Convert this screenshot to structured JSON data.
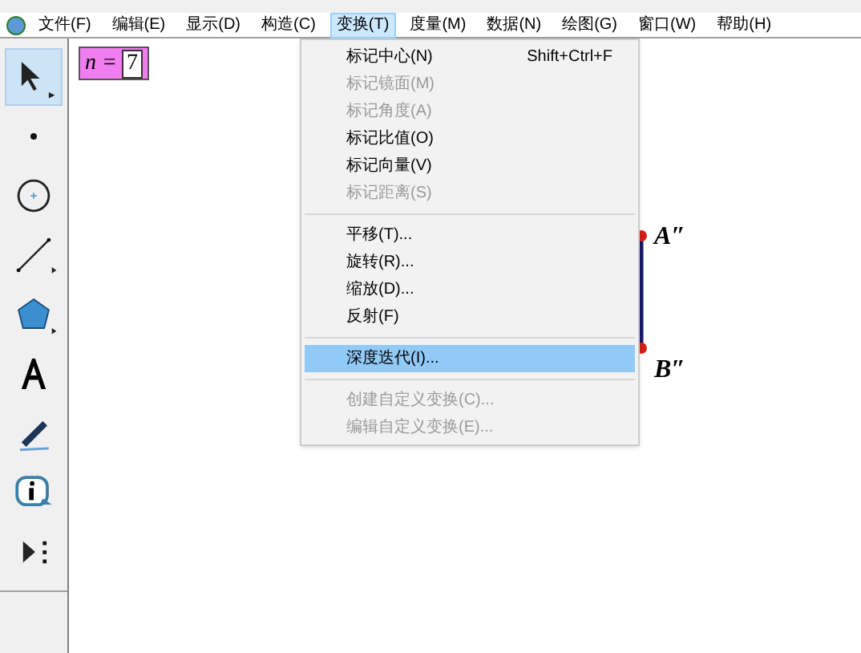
{
  "menubar": [
    {
      "label": "文件(F)",
      "selected": false
    },
    {
      "label": "编辑(E)",
      "selected": false
    },
    {
      "label": "显示(D)",
      "selected": false
    },
    {
      "label": "构造(C)",
      "selected": false
    },
    {
      "label": "变换(T)",
      "selected": true
    },
    {
      "label": "度量(M)",
      "selected": false
    },
    {
      "label": "数据(N)",
      "selected": false
    },
    {
      "label": "绘图(G)",
      "selected": false
    },
    {
      "label": "窗口(W)",
      "selected": false
    },
    {
      "label": "帮助(H)",
      "selected": false
    }
  ],
  "menu": {
    "groups": [
      [
        {
          "label": "标记中心(N)",
          "shortcut": "Shift+Ctrl+F",
          "disabled": false,
          "selected": false
        },
        {
          "label": "标记镜面(M)",
          "disabled": true,
          "selected": false
        },
        {
          "label": "标记角度(A)",
          "disabled": true,
          "selected": false
        },
        {
          "label": "标记比值(O)",
          "disabled": false,
          "selected": false
        },
        {
          "label": "标记向量(V)",
          "disabled": false,
          "selected": false
        },
        {
          "label": "标记距离(S)",
          "disabled": true,
          "selected": false
        }
      ],
      [
        {
          "label": "平移(T)...",
          "disabled": false,
          "selected": false
        },
        {
          "label": "旋转(R)...",
          "disabled": false,
          "selected": false
        },
        {
          "label": "缩放(D)...",
          "disabled": false,
          "selected": false
        },
        {
          "label": "反射(F)",
          "disabled": false,
          "selected": false
        }
      ],
      [
        {
          "label": "深度迭代(I)...",
          "disabled": false,
          "selected": true
        }
      ],
      [
        {
          "label": "创建自定义变换(C)...",
          "disabled": true,
          "selected": false
        },
        {
          "label": "编辑自定义变换(E)...",
          "disabled": true,
          "selected": false
        }
      ]
    ]
  },
  "tools": [
    {
      "kind": "arrow",
      "selected": true
    },
    {
      "kind": "point",
      "selected": false
    },
    {
      "kind": "compass",
      "selected": false
    },
    {
      "kind": "line",
      "selected": false
    },
    {
      "kind": "polygon",
      "selected": false
    },
    {
      "kind": "text",
      "selected": false
    },
    {
      "kind": "marker",
      "selected": false
    },
    {
      "kind": "info",
      "selected": false
    },
    {
      "kind": "custom",
      "selected": false
    }
  ],
  "canvas": {
    "parameter": {
      "name": "n",
      "equals": "=",
      "value": "7"
    },
    "segment": {
      "start_label": "A″",
      "end_label": "B″"
    }
  }
}
